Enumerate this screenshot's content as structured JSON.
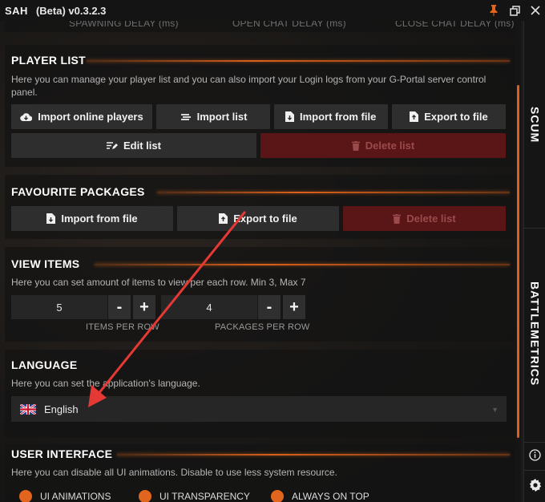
{
  "app": {
    "logo": "SAH",
    "title": "(Beta)  v0.3.2.3"
  },
  "top_remnant": {
    "labels": [
      "SPAWNING DELAY (ms)",
      "OPEN CHAT DELAY (ms)",
      "CLOSE CHAT DELAY (ms)"
    ]
  },
  "player_list": {
    "title": "PLAYER LIST",
    "description": "Here you can manage your player list and you can also import your Login logs from your G-Portal server control panel.",
    "buttons": {
      "import_online": "Import online players",
      "import_list": "Import list",
      "import_file": "Import from file",
      "export_file": "Export to file",
      "edit_list": "Edit list",
      "delete_list": "Delete list"
    }
  },
  "favourite_packages": {
    "title": "FAVOURITE PACKAGES",
    "buttons": {
      "import_file": "Import from file",
      "export_file": "Export to file",
      "delete_list": "Delete list"
    }
  },
  "view_items": {
    "title": "VIEW ITEMS",
    "description": "Here you can set amount of items to view per each row. Min 3, Max 7",
    "items_per_row": {
      "value": "5",
      "label": "ITEMS PER ROW"
    },
    "packages_per_row": {
      "value": "4",
      "label": "PACKAGES PER ROW"
    },
    "minus": "-",
    "plus": "+"
  },
  "language": {
    "title": "LANGUAGE",
    "description": "Here you can set the application's language.",
    "selected": "English",
    "flag_icon": "uk-flag-icon"
  },
  "user_interface": {
    "title": "USER INTERFACE",
    "description": "Here you can disable all UI animations. Disable to use less system resource.",
    "toggles": [
      "UI ANIMATIONS",
      "UI TRANSPARENCY",
      "ALWAYS ON TOP"
    ]
  },
  "rail": {
    "tabs": [
      "SCUM",
      "BATTLEMETRICS"
    ],
    "info_icon": "info-icon",
    "settings_icon": "gear-icon"
  },
  "colors": {
    "accent": "#e2651e",
    "danger_bg": "#5a1616",
    "arrow": "#e53935"
  }
}
